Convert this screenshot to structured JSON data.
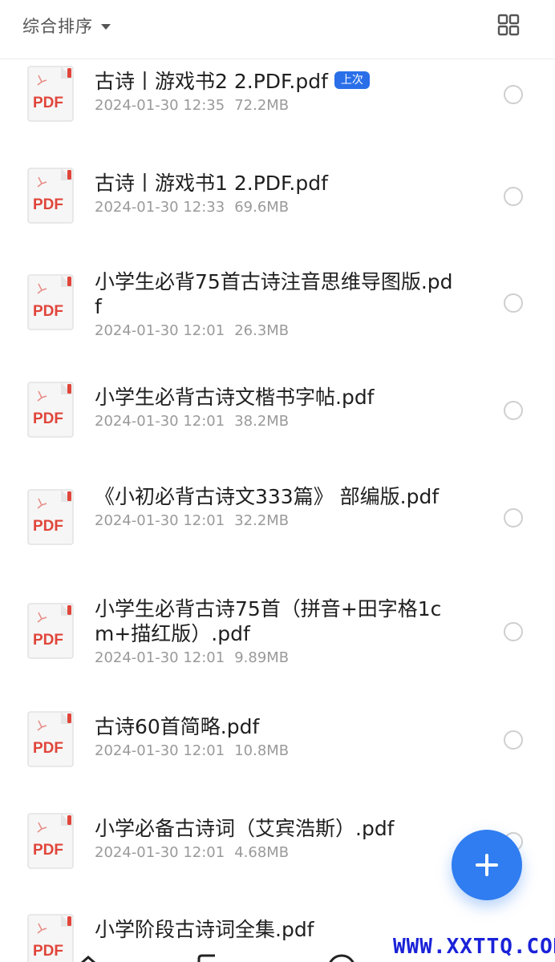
{
  "header": {
    "sort_label": "综合排序",
    "sort_icon": "caret-down-icon",
    "view_toggle_icon": "grid-view-icon"
  },
  "files": [
    {
      "name": "古诗丨游戏书2 2.PDF.pdf",
      "date": "2024-01-30 12:35",
      "size": "72.2MB",
      "badge": "上次"
    },
    {
      "name": "古诗丨游戏书1 2.PDF.pdf",
      "date": "2024-01-30 12:33",
      "size": "69.6MB"
    },
    {
      "name": "小学生必背75首古诗注音思维导图版.pdf",
      "date": "2024-01-30 12:01",
      "size": "26.3MB"
    },
    {
      "name": "小学生必背古诗文楷书字帖.pdf",
      "date": "2024-01-30 12:01",
      "size": "38.2MB"
    },
    {
      "name": "《小初必背古诗文333篇》 部编版.pdf",
      "date": "2024-01-30 12:01",
      "size": "32.2MB"
    },
    {
      "name": "小学生必背古诗75首（拼音+田字格1cm+描红版）.pdf",
      "date": "2024-01-30 12:01",
      "size": "9.89MB"
    },
    {
      "name": "古诗60首简略.pdf",
      "date": "2024-01-30 12:01",
      "size": "10.8MB"
    },
    {
      "name": "小学必备古诗词（艾宾浩斯）.pdf",
      "date": "2024-01-30 12:01",
      "size": "4.68MB"
    },
    {
      "name": "小学阶段古诗词全集.pdf",
      "date": "",
      "size": ""
    }
  ],
  "file_icon_label": "PDF",
  "fab": {
    "icon": "plus-icon"
  },
  "watermark": "WWW.XXTTQ.COM",
  "colors": {
    "accent": "#2f7df0",
    "badge": "#2a6fe8",
    "pdf_red": "#e0453a",
    "watermark": "#1a22d8"
  }
}
